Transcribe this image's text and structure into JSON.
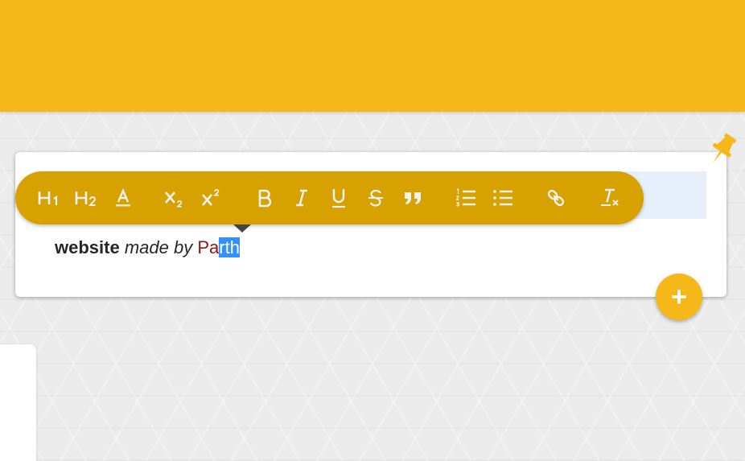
{
  "note": {
    "text_bold": "website",
    "text_italic": "made by",
    "text_colored": "Pa",
    "text_selected": "rth"
  },
  "toolbar": {
    "buttons": [
      {
        "name": "heading-1-button",
        "icon": "h1-icon",
        "label": "H₁"
      },
      {
        "name": "heading-2-button",
        "icon": "h2-icon",
        "label": "H₂"
      },
      {
        "name": "text-color-button",
        "icon": "font-color-icon",
        "label": "A"
      },
      {
        "name": "subscript-button",
        "icon": "subscript-icon",
        "label": "x₂"
      },
      {
        "name": "superscript-button",
        "icon": "superscript-icon",
        "label": "x²"
      },
      {
        "name": "bold-button",
        "icon": "bold-icon",
        "label": "B"
      },
      {
        "name": "italic-button",
        "icon": "italic-icon",
        "label": "I"
      },
      {
        "name": "underline-button",
        "icon": "underline-icon",
        "label": "U"
      },
      {
        "name": "strikethrough-button",
        "icon": "strikethrough-icon",
        "label": "S"
      },
      {
        "name": "blockquote-button",
        "icon": "quote-icon",
        "label": "”"
      },
      {
        "name": "ordered-list-button",
        "icon": "ordered-list-icon"
      },
      {
        "name": "bullet-list-button",
        "icon": "bullet-list-icon"
      },
      {
        "name": "link-button",
        "icon": "link-icon"
      },
      {
        "name": "clear-format-button",
        "icon": "clear-format-icon",
        "label": "T"
      }
    ]
  },
  "fab": {
    "label": "+",
    "icon": "plus-icon"
  },
  "colors": {
    "header": "#f4b918",
    "toolbar": "#d7a100",
    "selection": "#3390ff",
    "colored_text": "#9c0e0e"
  }
}
